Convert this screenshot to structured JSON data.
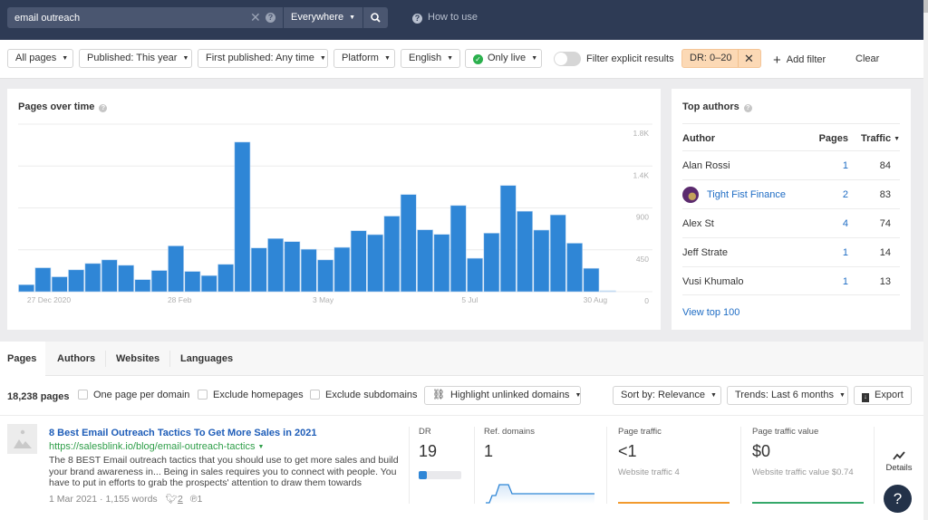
{
  "header": {
    "search_value": "email outreach",
    "search_placeholder": "",
    "scope": "Everywhere",
    "how_to_use": "How to use"
  },
  "filters": {
    "all_pages": "All pages",
    "published": "Published: This year",
    "first_published": "First published: Any time",
    "platform": "Platform",
    "language": "English",
    "only_live": "Only live",
    "explicit_toggle_label": "Filter explicit results",
    "explicit_toggle_on": false,
    "dr_chip": "DR: 0–20",
    "add_filter": "Add filter",
    "clear": "Clear"
  },
  "chart_data": {
    "type": "bar",
    "title": "Pages over time",
    "xlabel": "",
    "ylabel": "",
    "x_tick_labels": [
      "27 Dec 2020",
      "28 Feb",
      "3 May",
      "5 Jul",
      "30 Aug"
    ],
    "y_tick_labels": [
      "0",
      "450",
      "900",
      "1.4K",
      "1.8K"
    ],
    "ylim": [
      0,
      1800
    ],
    "grid": true,
    "values": [
      75,
      257,
      160,
      235,
      303,
      342,
      284,
      130,
      228,
      492,
      218,
      173,
      294,
      1607,
      470,
      571,
      538,
      456,
      342,
      476,
      655,
      613,
      812,
      1044,
      665,
      616,
      926,
      359,
      629,
      1141,
      864,
      662,
      825,
      521,
      251,
      10
    ],
    "color": "#2f86d6"
  },
  "top_authors": {
    "title": "Top authors",
    "columns": {
      "author": "Author",
      "pages": "Pages",
      "traffic": "Traffic"
    },
    "rows": [
      {
        "name": "Alan Rossi",
        "pages": "1",
        "traffic": "84",
        "linked": false
      },
      {
        "name": "Tight Fist Finance",
        "pages": "2",
        "traffic": "83",
        "linked": true
      },
      {
        "name": "Alex St",
        "pages": "4",
        "traffic": "74",
        "linked": false
      },
      {
        "name": "Jeff Strate",
        "pages": "1",
        "traffic": "14",
        "linked": false
      },
      {
        "name": "Vusi Khumalo",
        "pages": "1",
        "traffic": "13",
        "linked": false
      }
    ],
    "view_top": "View top 100"
  },
  "tabs": [
    "Pages",
    "Authors",
    "Websites",
    "Languages"
  ],
  "toolbar": {
    "count": "18,238 pages",
    "one_per_domain": "One page per domain",
    "exclude_homepages": "Exclude homepages",
    "exclude_subdomains": "Exclude subdomains",
    "highlight": "Highlight unlinked domains",
    "sort": "Sort by: Relevance",
    "trends": "Trends: Last 6 months",
    "export": "Export"
  },
  "result": {
    "title": "8 Best Email Outreach Tactics To Get More Sales in 2021",
    "url": "https://salesblink.io/blog/email-outreach-tactics",
    "description": "The 8 BEST Email outreach tactics that you should use to get more sales and build your brand awareness in... Being in sales requires you to connect with people. You have to put in efforts to grab the prospects' attention to draw them towards",
    "date": "1 Mar 2021",
    "words": "1,155 words",
    "tweets": "2",
    "pins": "1",
    "dr_label": "DR",
    "dr_value": "19",
    "dr_fraction": 0.19,
    "ref_label": "Ref. domains",
    "ref_value": "1",
    "traffic_label": "Page traffic",
    "traffic_value": "<1",
    "traffic_sub": "Website traffic 4",
    "value_label": "Page traffic value",
    "value_value": "$0",
    "value_sub": "Website traffic value $0.74",
    "details": "Details"
  },
  "help_fab": "?"
}
